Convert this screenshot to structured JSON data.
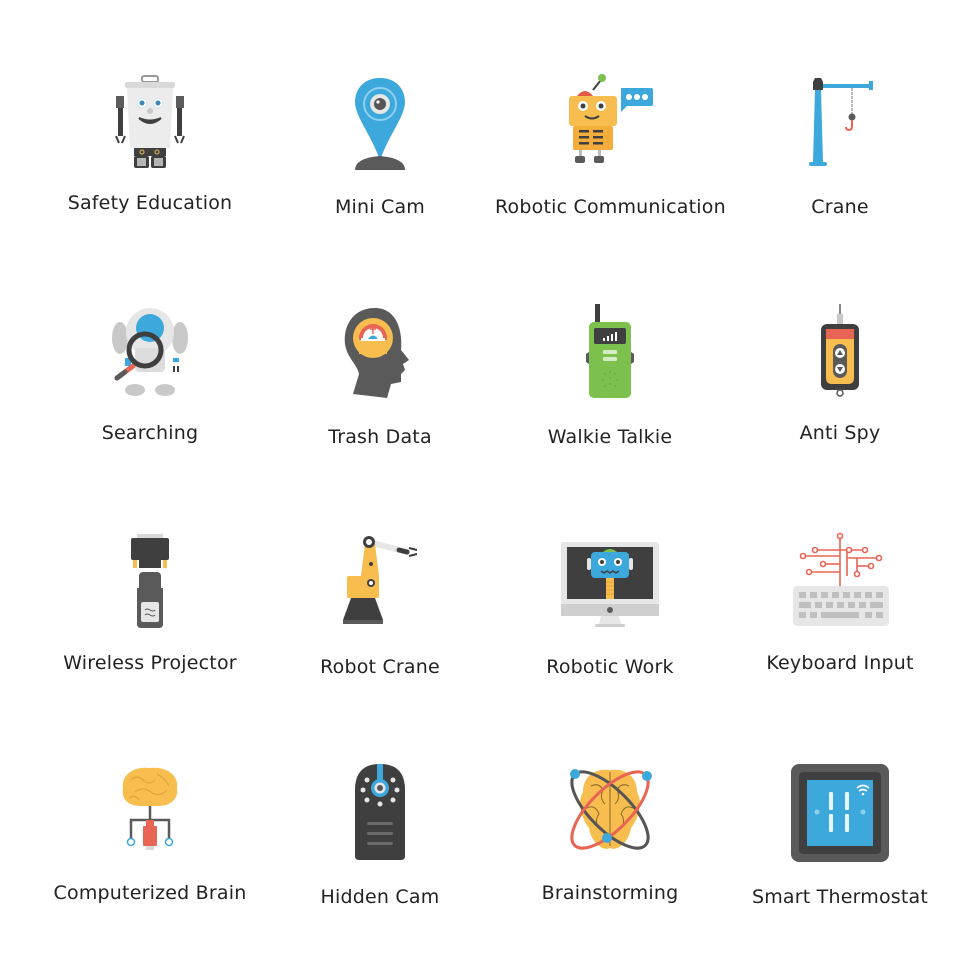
{
  "items": [
    {
      "label": "Safety Education",
      "icon": "robot-trash-can-icon"
    },
    {
      "label": "Mini Cam",
      "icon": "location-pin-camera-icon"
    },
    {
      "label": "Robotic Communication",
      "icon": "robot-chat-bubble-icon"
    },
    {
      "label": "Crane",
      "icon": "crane-hook-icon"
    },
    {
      "label": "Searching",
      "icon": "robot-magnifier-icon"
    },
    {
      "label": "Trash Data",
      "icon": "head-gear-gauge-icon"
    },
    {
      "label": "Walkie Talkie",
      "icon": "walkie-talkie-icon"
    },
    {
      "label": "Anti Spy",
      "icon": "remote-detector-icon"
    },
    {
      "label": "Wireless Projector",
      "icon": "vga-adapter-icon"
    },
    {
      "label": "Robot Crane",
      "icon": "robotic-arm-icon"
    },
    {
      "label": "Robotic Work",
      "icon": "monitor-robot-icon"
    },
    {
      "label": "Keyboard Input",
      "icon": "keyboard-circuit-icon"
    },
    {
      "label": "Computerized Brain",
      "icon": "brain-usb-icon"
    },
    {
      "label": "Hidden Cam",
      "icon": "hidden-camera-icon"
    },
    {
      "label": "Brainstorming",
      "icon": "brain-orbit-icon"
    },
    {
      "label": "Smart Thermostat",
      "icon": "smart-thermostat-icon"
    }
  ],
  "colors": {
    "blue": "#3da8dc",
    "yellow": "#f7bd4f",
    "dark": "#3f3f3f",
    "gray": "#6b6b6b",
    "light_gray": "#e6e6e6",
    "red": "#e86454",
    "green": "#7cc04d"
  }
}
